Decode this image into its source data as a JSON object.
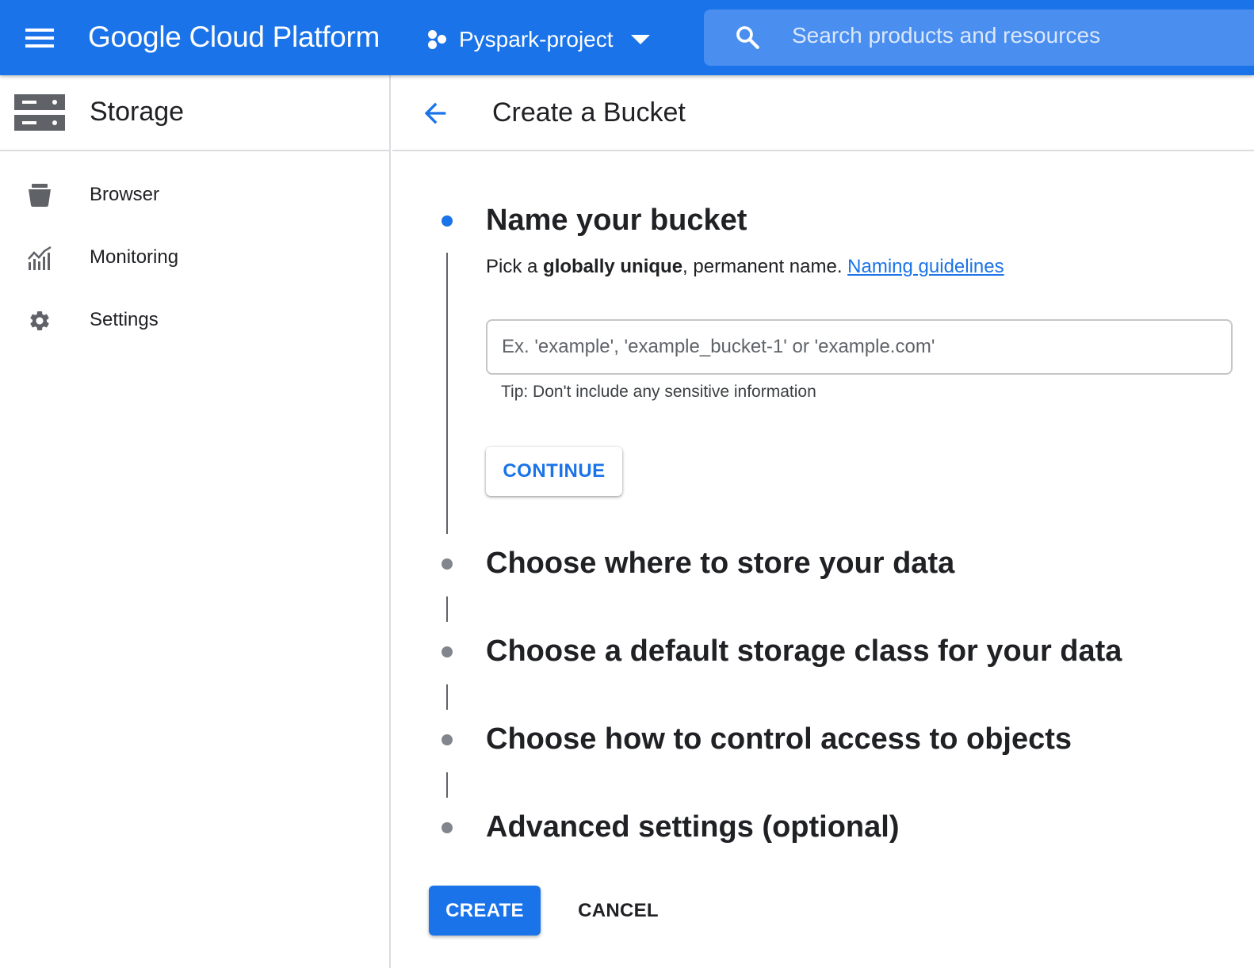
{
  "topbar": {
    "brand": "Google Cloud Platform",
    "project": "Pyspark-project",
    "search_placeholder": "Search products and resources",
    "color": "#1a73e8"
  },
  "sidebar": {
    "title": "Storage",
    "items": [
      {
        "label": "Browser",
        "icon": "bucket-icon"
      },
      {
        "label": "Monitoring",
        "icon": "chart-icon"
      },
      {
        "label": "Settings",
        "icon": "gear-icon"
      }
    ]
  },
  "main": {
    "title": "Create a Bucket",
    "steps": [
      {
        "title": "Name your bucket",
        "active": true
      },
      {
        "title": "Choose where to store your data",
        "active": false
      },
      {
        "title": "Choose a default storage class for your data",
        "active": false
      },
      {
        "title": "Choose how to control access to objects",
        "active": false
      },
      {
        "title": "Advanced settings (optional)",
        "active": false
      }
    ],
    "name_step": {
      "desc_prefix": "Pick a ",
      "desc_bold": "globally unique",
      "desc_suffix": ", permanent name. ",
      "link": "Naming guidelines",
      "input_value": "",
      "input_placeholder": "Ex. 'example', 'example_bucket-1' or 'example.com'",
      "tip": "Tip: Don't include any sensitive information",
      "continue_label": "CONTINUE"
    },
    "create_label": "CREATE",
    "cancel_label": "CANCEL"
  }
}
